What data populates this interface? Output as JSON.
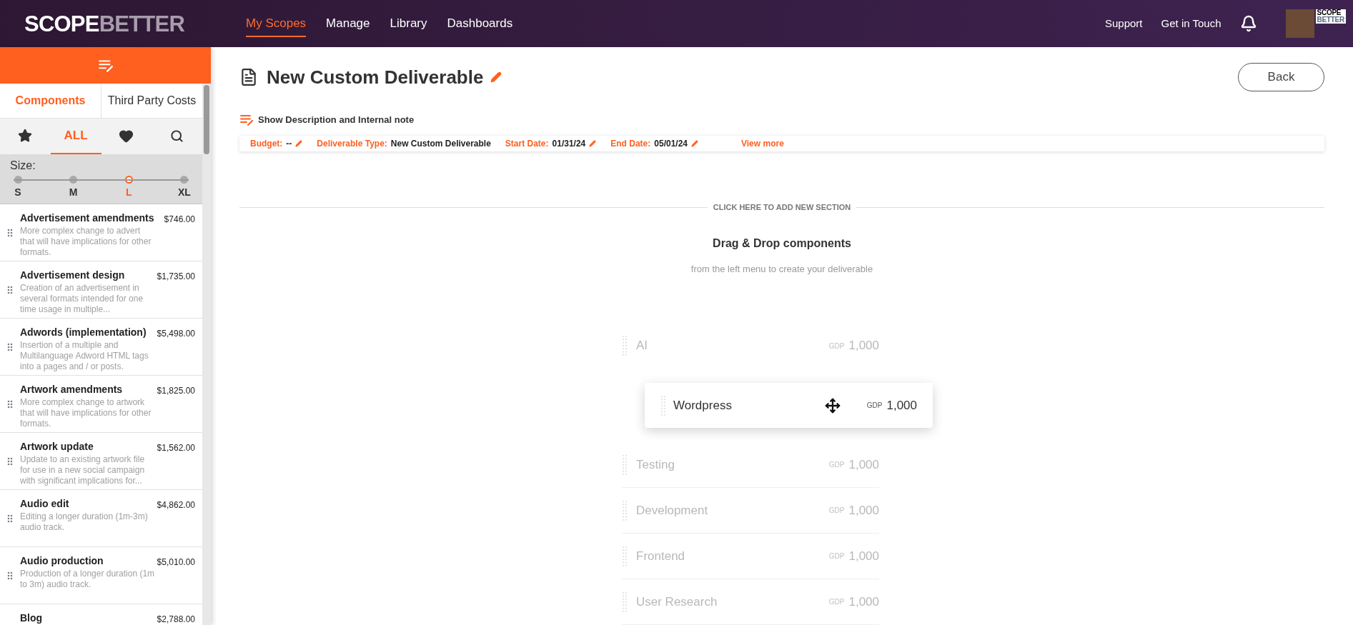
{
  "header": {
    "logo": {
      "first": "SCOPE",
      "second": "BETTER"
    },
    "nav": [
      {
        "label": "My Scopes",
        "selected": true
      },
      {
        "label": "Manage",
        "selected": false
      },
      {
        "label": "Library",
        "selected": false
      },
      {
        "label": "Dashboards",
        "selected": false
      }
    ],
    "links": [
      "Support",
      "Get in Touch"
    ],
    "account_logo": {
      "first": "SCOPE",
      "second": "BETTER"
    }
  },
  "sidebar": {
    "tabs": [
      {
        "label": "Components",
        "selected": true
      },
      {
        "label": "Third Party Costs",
        "selected": false
      }
    ],
    "filters": [
      {
        "kind": "star",
        "selected": false
      },
      {
        "kind": "text",
        "label": "ALL",
        "selected": true
      },
      {
        "kind": "heart",
        "selected": false
      },
      {
        "kind": "search",
        "selected": false
      }
    ],
    "size": {
      "label": "Size:",
      "options": [
        {
          "label": "S",
          "selected": false
        },
        {
          "label": "M",
          "selected": false
        },
        {
          "label": "L",
          "selected": true
        },
        {
          "label": "XL",
          "selected": false
        }
      ]
    },
    "items": [
      {
        "title": "Advertisement amendments",
        "description": "More complex change to advert that will have implications for other formats.",
        "price": "$746.00"
      },
      {
        "title": "Advertisement design",
        "description": "Creation of an advertisement in several formats intended for one time usage in multiple...",
        "price": "$1,735.00"
      },
      {
        "title": "Adwords (implementation)",
        "description": "Insertion of a multiple and Multilanguage Adword HTML tags into a pages and / or posts.",
        "price": "$5,498.00"
      },
      {
        "title": "Artwork amendments",
        "description": "More complex change to artwork that will have implications for other formats.",
        "price": "$1,825.00"
      },
      {
        "title": "Artwork update",
        "description": "Update to an existing artwork file for use in a new social campaign with significant implications for...",
        "price": "$1,562.00"
      },
      {
        "title": "Audio edit",
        "description": "Editing a longer duration (1m-3m) audio track.",
        "price": "$4,862.00"
      },
      {
        "title": "Audio production",
        "description": "Production of a longer duration (1m to 3m) audio track.",
        "price": "$5,010.00"
      },
      {
        "title": "Blog",
        "price": "$2,788.00"
      }
    ]
  },
  "main": {
    "title": "New Custom Deliverable",
    "back": "Back",
    "show_description": "Show Description and Internal note",
    "info": [
      {
        "label": "Budget:",
        "value": "--",
        "editable": true
      },
      {
        "label": "Deliverable Type:",
        "value": "New Custom Deliverable",
        "editable": false
      },
      {
        "label": "Start Date:",
        "value": "01/31/24",
        "editable": true
      },
      {
        "label": "End Date:",
        "value": "05/01/24",
        "editable": true
      }
    ],
    "view_more": "View more",
    "add_section": "CLICK HERE TO ADD NEW SECTION",
    "empty_title": "Drag & Drop components",
    "empty_subtitle": "from the left menu to create your deliverable",
    "example_rows": [
      {
        "name": "AI",
        "currency": "GDP",
        "amount": "1,000",
        "dragging": false
      },
      {
        "name": "Wordpress",
        "currency": "GDP",
        "amount": "1,000",
        "dragging": true
      },
      {
        "name": "Testing",
        "currency": "GDP",
        "amount": "1,000",
        "dragging": false
      },
      {
        "name": "Development",
        "currency": "GDP",
        "amount": "1,000",
        "dragging": false
      },
      {
        "name": "Frontend",
        "currency": "GDP",
        "amount": "1,000",
        "dragging": false
      },
      {
        "name": "User Research",
        "currency": "GDP",
        "amount": "1,000",
        "dragging": false
      }
    ]
  }
}
